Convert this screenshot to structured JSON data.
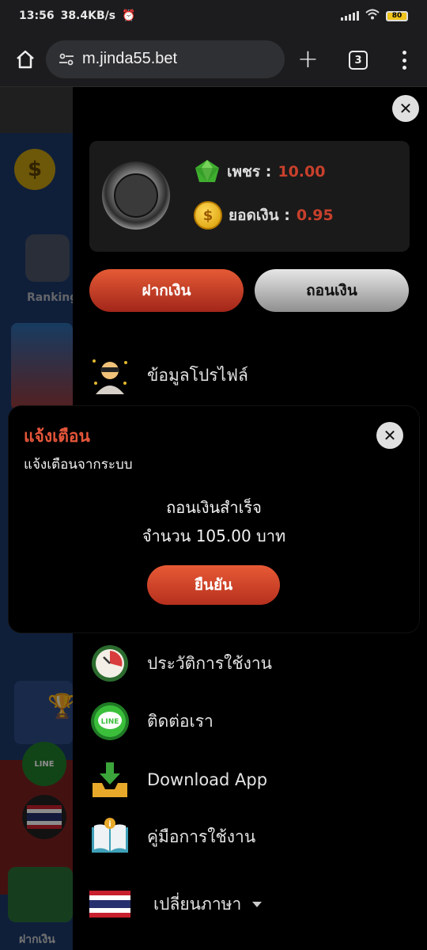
{
  "status_bar": {
    "time": "13:56",
    "net_speed": "38.4KB/s",
    "battery": "80"
  },
  "browser": {
    "url": "m.jinda55.bet",
    "tab_count": "3"
  },
  "background_page": {
    "ranking_label": "Ranking",
    "deposit_label": "ฝากเงิน",
    "line_bubble": "LINE"
  },
  "wallet": {
    "diamond_label": "เพชร :",
    "diamond_value": "10.00",
    "balance_label": "ยอดเงิน :",
    "balance_value": "0.95"
  },
  "actions": {
    "deposit": "ฝากเงิน",
    "withdraw": "ถอนเงิน"
  },
  "menu": {
    "profile": "ข้อมูลโปรไฟล์",
    "history": "ประวัติการใช้งาน",
    "contact": "ติดต่อเรา",
    "download": "Download App",
    "manual": "คู่มือการใช้งาน",
    "language": "เปลี่ยนภาษา"
  },
  "modal": {
    "title": "แจ้งเตือน",
    "subtitle": "แจ้งเตือนจากระบบ",
    "message_line1": "ถอนเงินสำเร็จ",
    "message_line2": "จำนวน 105.00 บาท",
    "confirm": "ยืนยัน"
  },
  "colors": {
    "accent_red": "#c8402c",
    "button_red": "#d4442a",
    "drawer_bg": "#000000",
    "wallet_bg": "#1a1a1a"
  }
}
